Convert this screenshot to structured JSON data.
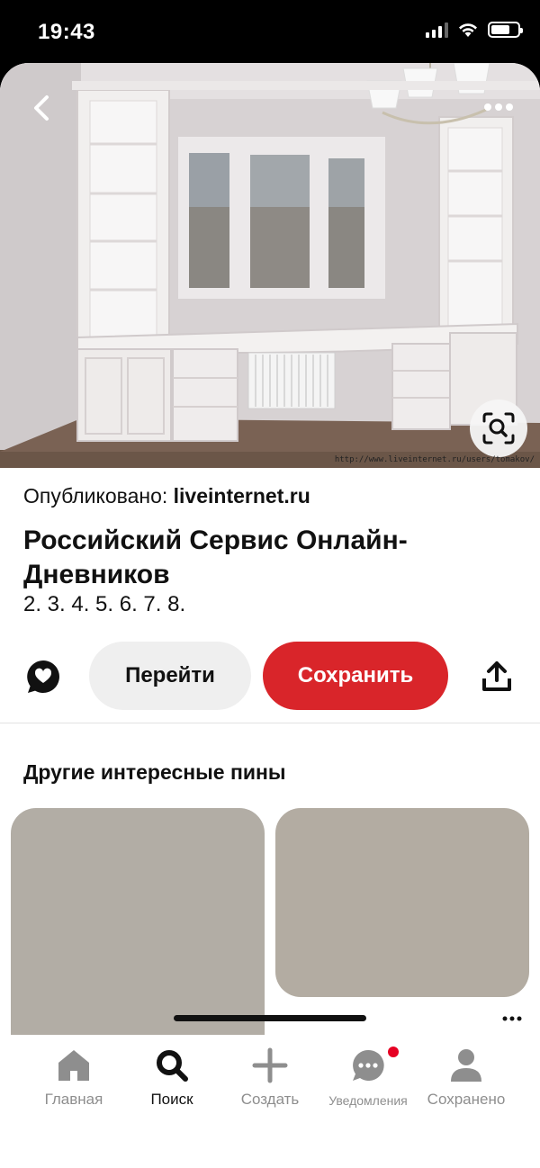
{
  "status_bar": {
    "time": "19:43",
    "icons": [
      "signal-icon",
      "wifi-icon",
      "battery-icon"
    ]
  },
  "hero": {
    "image_alt_icon": "room-photo",
    "watermark": "http://www.liveinternet.ru/users/tomakov/",
    "back_icon": "chevron-left-icon",
    "more_icon": "more-horizontal-icon",
    "lens_icon": "visual-search-icon"
  },
  "pin": {
    "published_prefix": "Опубликовано:",
    "published_source": "liveinternet.ru",
    "title": "Российский Сервис Онлайн-Дневников",
    "description": "2. 3. 4. 5. 6. 7. 8."
  },
  "actions": {
    "comment_icon": "comment-heart-icon",
    "visit_label": "Перейти",
    "save_label": "Сохранить",
    "share_icon": "share-icon",
    "save_color": "#d9252a",
    "visit_color": "#efefef"
  },
  "more_pins": {
    "heading": "Другие интересные пины",
    "placeholder_colors": [
      "#b2ada5",
      "#b3aca2"
    ]
  },
  "tab_bar": {
    "items": [
      {
        "label": "Главная",
        "icon": "home-icon",
        "active": false
      },
      {
        "label": "Поиск",
        "icon": "search-icon",
        "active": true
      },
      {
        "label": "Создать",
        "icon": "plus-icon",
        "active": false
      },
      {
        "label": "Уведомления",
        "icon": "chat-bubble-icon",
        "active": false,
        "badge": true
      },
      {
        "label": "Сохранено",
        "icon": "person-icon",
        "active": false
      }
    ],
    "badge_color": "#e60023"
  }
}
